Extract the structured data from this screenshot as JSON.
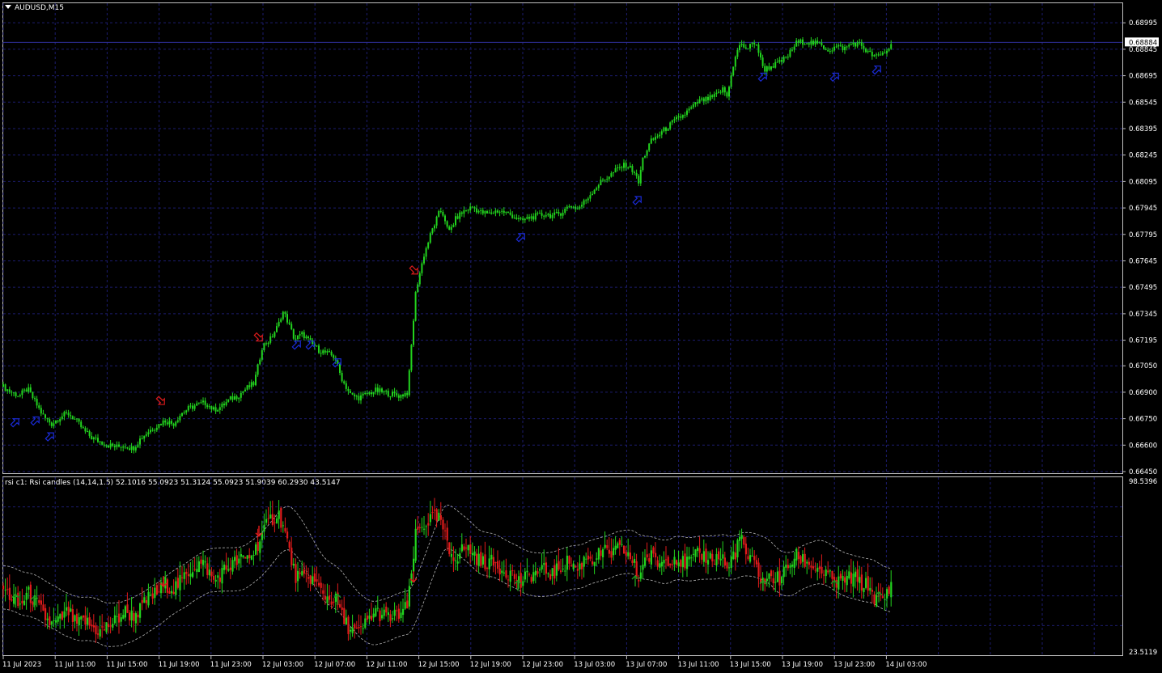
{
  "window": {
    "symbol_title": "AUDUSD,M15",
    "indicator_title": "rsi c1: Rsi candles (14,14,1.5) 52.1016 55.0923 51.3124 55.0923 51.9039 60.2930 43.5147"
  },
  "colors": {
    "background": "#000000",
    "grid": "#1c1c6e",
    "bull": "#22d31e",
    "bear": "#e01b1b",
    "buy_arrow": "#1a2bd8",
    "sell_arrow": "#d81a1a",
    "band": "#b4b4b4",
    "price_line": "#2f2f9a",
    "axis_text": "#ffffff"
  },
  "chart_data": [
    {
      "type": "candlestick",
      "symbol": "AUDUSD",
      "timeframe": "M15",
      "y_ticks": [
        "0.68995",
        "0.68845",
        "0.68695",
        "0.68545",
        "0.68395",
        "0.68245",
        "0.68095",
        "0.67945",
        "0.67795",
        "0.67645",
        "0.67495",
        "0.67345",
        "0.67195",
        "0.67050",
        "0.66900",
        "0.66750",
        "0.66600",
        "0.66450"
      ],
      "ylim": [
        0.6645,
        0.6906
      ],
      "current_price": "0.68884",
      "price_path": [
        [
          0,
          0.6693
        ],
        [
          10,
          0.669
        ],
        [
          20,
          0.6688
        ],
        [
          30,
          0.6692
        ],
        [
          40,
          0.6684
        ],
        [
          50,
          0.6676
        ],
        [
          60,
          0.6672
        ],
        [
          70,
          0.6676
        ],
        [
          80,
          0.6678
        ],
        [
          90,
          0.6674
        ],
        [
          100,
          0.6668
        ],
        [
          110,
          0.6664
        ],
        [
          120,
          0.6662
        ],
        [
          130,
          0.666
        ],
        [
          140,
          0.6659
        ],
        [
          150,
          0.666
        ],
        [
          160,
          0.6658
        ],
        [
          170,
          0.6664
        ],
        [
          180,
          0.6668
        ],
        [
          190,
          0.6671
        ],
        [
          200,
          0.6674
        ],
        [
          210,
          0.6672
        ],
        [
          220,
          0.6678
        ],
        [
          230,
          0.6681
        ],
        [
          240,
          0.6683
        ],
        [
          250,
          0.6684
        ],
        [
          260,
          0.668
        ],
        [
          270,
          0.6682
        ],
        [
          280,
          0.6686
        ],
        [
          290,
          0.6688
        ],
        [
          300,
          0.6692
        ],
        [
          310,
          0.6695
        ],
        [
          315,
          0.6705
        ],
        [
          320,
          0.6716
        ],
        [
          330,
          0.672
        ],
        [
          340,
          0.6728
        ],
        [
          345,
          0.6736
        ],
        [
          350,
          0.6732
        ],
        [
          360,
          0.672
        ],
        [
          370,
          0.6723
        ],
        [
          380,
          0.6718
        ],
        [
          390,
          0.6714
        ],
        [
          400,
          0.6712
        ],
        [
          410,
          0.671
        ],
        [
          415,
          0.6702
        ],
        [
          420,
          0.6696
        ],
        [
          430,
          0.6688
        ],
        [
          440,
          0.6687
        ],
        [
          450,
          0.6689
        ],
        [
          460,
          0.6691
        ],
        [
          470,
          0.669
        ],
        [
          480,
          0.6689
        ],
        [
          490,
          0.6688
        ],
        [
          500,
          0.669
        ],
        [
          505,
          0.672
        ],
        [
          510,
          0.6748
        ],
        [
          520,
          0.6768
        ],
        [
          530,
          0.6782
        ],
        [
          540,
          0.6793
        ],
        [
          545,
          0.679
        ],
        [
          550,
          0.678
        ],
        [
          560,
          0.6789
        ],
        [
          570,
          0.6793
        ],
        [
          580,
          0.6795
        ],
        [
          590,
          0.6792
        ],
        [
          600,
          0.6791
        ],
        [
          610,
          0.6793
        ],
        [
          620,
          0.6792
        ],
        [
          630,
          0.679
        ],
        [
          640,
          0.6787
        ],
        [
          650,
          0.6789
        ],
        [
          660,
          0.679
        ],
        [
          670,
          0.6791
        ],
        [
          680,
          0.679
        ],
        [
          690,
          0.6792
        ],
        [
          700,
          0.6796
        ],
        [
          710,
          0.6794
        ],
        [
          720,
          0.6799
        ],
        [
          730,
          0.6805
        ],
        [
          740,
          0.681
        ],
        [
          750,
          0.6813
        ],
        [
          760,
          0.6817
        ],
        [
          770,
          0.6819
        ],
        [
          780,
          0.6815
        ],
        [
          785,
          0.6808
        ],
        [
          790,
          0.6822
        ],
        [
          800,
          0.6832
        ],
        [
          810,
          0.6836
        ],
        [
          820,
          0.684
        ],
        [
          830,
          0.6844
        ],
        [
          840,
          0.6847
        ],
        [
          850,
          0.6851
        ],
        [
          860,
          0.6855
        ],
        [
          870,
          0.6856
        ],
        [
          880,
          0.6858
        ],
        [
          890,
          0.6862
        ],
        [
          895,
          0.6857
        ],
        [
          900,
          0.6872
        ],
        [
          905,
          0.688
        ],
        [
          910,
          0.6887
        ],
        [
          920,
          0.6885
        ],
        [
          930,
          0.6889
        ],
        [
          935,
          0.688
        ],
        [
          940,
          0.6873
        ],
        [
          950,
          0.6875
        ],
        [
          960,
          0.6877
        ],
        [
          970,
          0.6881
        ],
        [
          980,
          0.6888
        ],
        [
          990,
          0.6889
        ],
        [
          1000,
          0.6888
        ],
        [
          1010,
          0.6887
        ],
        [
          1020,
          0.6884
        ],
        [
          1030,
          0.6886
        ],
        [
          1040,
          0.6885
        ],
        [
          1050,
          0.6888
        ],
        [
          1060,
          0.6887
        ],
        [
          1070,
          0.6882
        ],
        [
          1080,
          0.688
        ],
        [
          1090,
          0.6883
        ],
        [
          1100,
          0.6888
        ]
      ],
      "buy_arrows": [
        [
          15,
          0.6673
        ],
        [
          40,
          0.6674
        ],
        [
          58,
          0.6665
        ],
        [
          363,
          0.6717
        ],
        [
          380,
          0.6717
        ],
        [
          413,
          0.6707
        ],
        [
          640,
          0.6778
        ],
        [
          784,
          0.6799
        ],
        [
          939,
          0.6869
        ],
        [
          1028,
          0.6869
        ],
        [
          1080,
          0.6873
        ]
      ],
      "sell_arrows": [
        [
          195,
          0.6685
        ],
        [
          316,
          0.6721
        ],
        [
          508,
          0.6759
        ]
      ]
    },
    {
      "type": "candlestick",
      "name": "Rsi candles (14,14,1.5)",
      "y_ticks": [
        "98.5396",
        "23.5119"
      ],
      "ylim": [
        23.5119,
        98.5396
      ],
      "rsi_path": [
        [
          0,
          52
        ],
        [
          10,
          48
        ],
        [
          20,
          44
        ],
        [
          30,
          50
        ],
        [
          40,
          46
        ],
        [
          50,
          40
        ],
        [
          60,
          36
        ],
        [
          70,
          38
        ],
        [
          80,
          42
        ],
        [
          90,
          36
        ],
        [
          100,
          38
        ],
        [
          110,
          35
        ],
        [
          120,
          33
        ],
        [
          130,
          36
        ],
        [
          140,
          38
        ],
        [
          150,
          42
        ],
        [
          160,
          40
        ],
        [
          170,
          43
        ],
        [
          180,
          48
        ],
        [
          190,
          50
        ],
        [
          200,
          54
        ],
        [
          210,
          52
        ],
        [
          220,
          55
        ],
        [
          230,
          60
        ],
        [
          240,
          63
        ],
        [
          250,
          62
        ],
        [
          260,
          55
        ],
        [
          270,
          59
        ],
        [
          280,
          62
        ],
        [
          290,
          64
        ],
        [
          300,
          65
        ],
        [
          310,
          68
        ],
        [
          315,
          72
        ],
        [
          320,
          76
        ],
        [
          330,
          82
        ],
        [
          340,
          85
        ],
        [
          345,
          80
        ],
        [
          350,
          74
        ],
        [
          360,
          58
        ],
        [
          370,
          56
        ],
        [
          380,
          57
        ],
        [
          390,
          52
        ],
        [
          400,
          48
        ],
        [
          410,
          47
        ],
        [
          415,
          44
        ],
        [
          420,
          38
        ],
        [
          430,
          34
        ],
        [
          440,
          32
        ],
        [
          450,
          38
        ],
        [
          460,
          42
        ],
        [
          470,
          40
        ],
        [
          480,
          39
        ],
        [
          490,
          41
        ],
        [
          500,
          44
        ],
        [
          505,
          60
        ],
        [
          510,
          76
        ],
        [
          520,
          80
        ],
        [
          530,
          83
        ],
        [
          540,
          82
        ],
        [
          545,
          76
        ],
        [
          550,
          68
        ],
        [
          560,
          66
        ],
        [
          570,
          70
        ],
        [
          580,
          68
        ],
        [
          590,
          63
        ],
        [
          600,
          64
        ],
        [
          610,
          62
        ],
        [
          620,
          60
        ],
        [
          630,
          58
        ],
        [
          640,
          54
        ],
        [
          650,
          58
        ],
        [
          660,
          59
        ],
        [
          670,
          60
        ],
        [
          680,
          58
        ],
        [
          690,
          62
        ],
        [
          700,
          64
        ],
        [
          710,
          60
        ],
        [
          720,
          66
        ],
        [
          730,
          65
        ],
        [
          740,
          68
        ],
        [
          750,
          67
        ],
        [
          760,
          69
        ],
        [
          770,
          68
        ],
        [
          780,
          62
        ],
        [
          785,
          55
        ],
        [
          790,
          64
        ],
        [
          800,
          66
        ],
        [
          810,
          63
        ],
        [
          820,
          65
        ],
        [
          830,
          66
        ],
        [
          840,
          63
        ],
        [
          850,
          64
        ],
        [
          860,
          67
        ],
        [
          870,
          66
        ],
        [
          880,
          65
        ],
        [
          890,
          66
        ],
        [
          895,
          58
        ],
        [
          900,
          66
        ],
        [
          905,
          68
        ],
        [
          910,
          75
        ],
        [
          920,
          65
        ],
        [
          930,
          62
        ],
        [
          935,
          57
        ],
        [
          940,
          55
        ],
        [
          950,
          57
        ],
        [
          960,
          56
        ],
        [
          970,
          62
        ],
        [
          980,
          66
        ],
        [
          990,
          64
        ],
        [
          1000,
          62
        ],
        [
          1010,
          60
        ],
        [
          1020,
          57
        ],
        [
          1030,
          54
        ],
        [
          1040,
          56
        ],
        [
          1050,
          57
        ],
        [
          1060,
          54
        ],
        [
          1070,
          53
        ],
        [
          1080,
          46
        ],
        [
          1090,
          48
        ],
        [
          1100,
          56
        ]
      ],
      "up_arrows": [
        [
          15,
          47
        ],
        [
          38,
          46
        ],
        [
          413,
          47
        ],
        [
          636,
          53
        ],
        [
          781,
          55
        ],
        [
          939,
          53
        ],
        [
          1027,
          53
        ],
        [
          1082,
          48
        ]
      ],
      "down_arrows": [
        [
          198,
          55
        ],
        [
          316,
          77
        ],
        [
          507,
          57
        ]
      ]
    }
  ],
  "time_axis": {
    "labels": [
      "11 Jul 2023",
      "11 Jul 11:00",
      "11 Jul 15:00",
      "11 Jul 19:00",
      "11 Jul 23:00",
      "12 Jul 03:00",
      "12 Jul 07:00",
      "12 Jul 11:00",
      "12 Jul 15:00",
      "12 Jul 19:00",
      "12 Jul 23:00",
      "13 Jul 03:00",
      "13 Jul 07:00",
      "13 Jul 11:00",
      "13 Jul 15:00",
      "13 Jul 19:00",
      "13 Jul 23:00",
      "14 Jul 03:00"
    ]
  }
}
